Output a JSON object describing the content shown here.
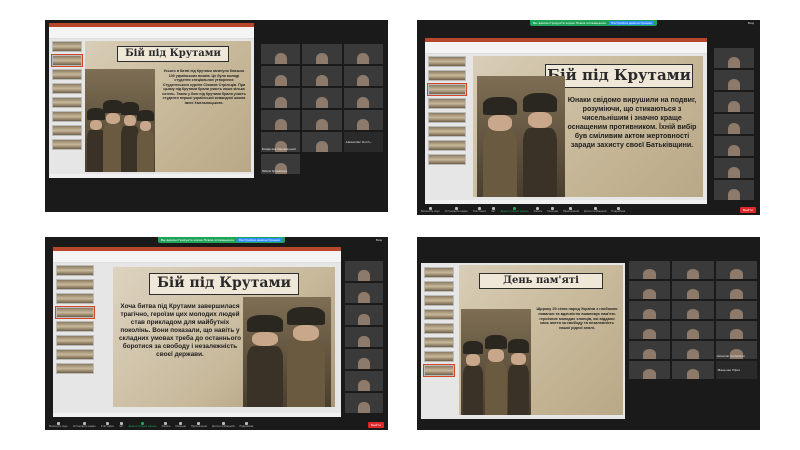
{
  "share_bar": {
    "text": "Вы демонстрируете экран  Новое оповещение",
    "option": "Настройки демонстрации"
  },
  "view_label": "Вид",
  "slides": {
    "s1_title": "Бій під Крутами",
    "s1_text": "Усього в битві під Крутами загинуло близько 100 українських вояків. Це були молоді студенти спеціальних утворених Студентського куреня Січових Стрільців. При цьому під Крутами брали участь лише кілька сотень. Також у бою під Крутами брали участь студенти першої української командної школи імені Хмельницького.",
    "s2_title": "Бій під Крутами",
    "s2_text": "Юнаки свідомо вирушили на подвиг, розуміючи, що стикаються з чисельнішим і значно краще оснащеним противником. Їхній вибір був сміливим актом жертовності заради захисту своєї Батьківщини.",
    "s3_title": "Бій під Крутами",
    "s3_text": "Хоча битва під Крутами завершилася трагічно, героїзм цих молодих людей став прикладом для майбутніх поколінь. Вони показали, що навіть у складних умовах треба до останнього боротися за свободу і незалежність своєї держави.",
    "s4_title": "День пам'яті",
    "s4_text": "Щороку 29 січня народ України з глибокою повагою та вдячністю вшановує пам'ять героїчних молодих хлопців, які віддали своє життя за свободу та незалежність нашої рідної землі."
  },
  "participants": {
    "p1": "Владислав Ламчаєвський",
    "p2": "Alexander Ovch...",
    "p3": "Alexander Ovcharenko",
    "p4": "Tetiana Tymoshenko",
    "p5": "Маньчак Юрія"
  },
  "toolbar": {
    "mic": "Включить звук",
    "video": "Остановить видео",
    "participants": "Участники",
    "chat": "Чат",
    "share": "Демонстрация экрана",
    "record": "Запись",
    "reactions": "Реакции",
    "apps": "Приложения",
    "whiteboard": "Доска сообщений",
    "more": "Подробнее",
    "end": "Выйти"
  },
  "colors": {
    "zoom_green": "#21a35a",
    "ppt_accent": "#b7472a",
    "end_red": "#e02828"
  }
}
